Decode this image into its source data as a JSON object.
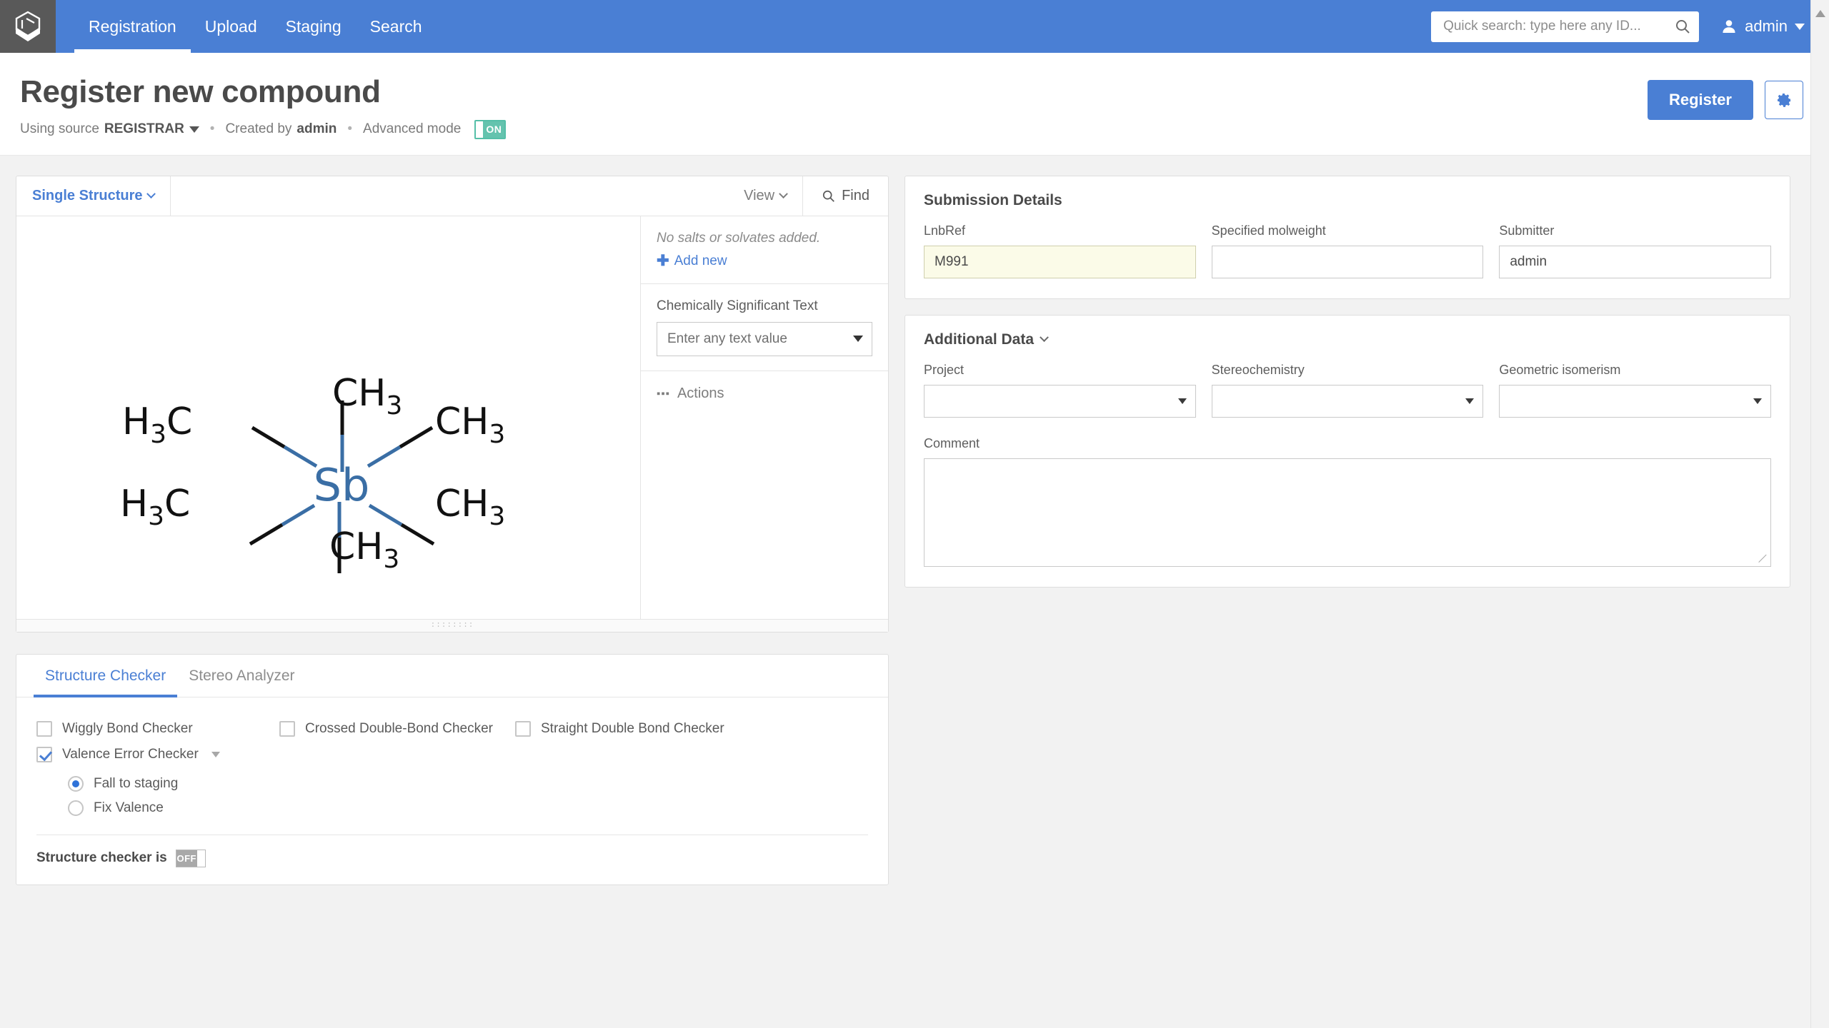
{
  "navbar": {
    "logo_icon": "hexagon-chevron-logo",
    "items": [
      {
        "label": "Registration",
        "active": true
      },
      {
        "label": "Upload",
        "active": false
      },
      {
        "label": "Staging",
        "active": false
      },
      {
        "label": "Search",
        "active": false
      }
    ],
    "search": {
      "placeholder": "Quick search: type here any ID...",
      "value": "",
      "icon": "search-icon"
    },
    "user": {
      "name": "admin",
      "icon": "user-avatar-icon",
      "caret": "chevron-down-icon"
    },
    "accent_color": "#4a7fd4"
  },
  "header": {
    "title": "Register new compound",
    "using_source_prefix": "Using source",
    "source": "REGISTRAR",
    "created_by_prefix": "Created by",
    "created_by": "admin",
    "advanced_mode_label": "Advanced mode",
    "advanced_mode_state": "ON",
    "register_button": "Register",
    "settings_icon": "gear-icon"
  },
  "editor": {
    "mode_label": "Single Structure",
    "view_label": "View",
    "find_label": "Find",
    "find_icon": "search-icon",
    "structure": {
      "center_atom": "Sb",
      "ligands": [
        "CH3",
        "CH3",
        "CH3",
        "H3C",
        "H3C",
        "H3C"
      ],
      "bond_color": "#3a6ea5",
      "atom_color": "#3a6ea5"
    }
  },
  "side_panel": {
    "salts_note": "No salts or solvates added.",
    "add_new_label": "Add new",
    "add_icon": "plus-icon",
    "cst_label": "Chemically Significant Text",
    "cst_placeholder": "Enter any text value",
    "cst_value": "",
    "actions_label": "Actions",
    "actions_icon": "ellipsis-icon"
  },
  "checker": {
    "tabs": [
      {
        "label": "Structure Checker",
        "active": true
      },
      {
        "label": "Stereo Analyzer",
        "active": false
      }
    ],
    "checkboxes": [
      {
        "label": "Wiggly Bond Checker",
        "checked": false
      },
      {
        "label": "Crossed Double-Bond Checker",
        "checked": false
      },
      {
        "label": "Straight Double Bond Checker",
        "checked": false
      },
      {
        "label": "Valence Error Checker",
        "checked": true
      }
    ],
    "radios": [
      {
        "label": "Fall to staging",
        "selected": true
      },
      {
        "label": "Fix Valence",
        "selected": false
      }
    ],
    "footer_label": "Structure checker is",
    "footer_state": "OFF"
  },
  "submission": {
    "title": "Submission Details",
    "fields": [
      {
        "label": "LnbRef",
        "value": "M991",
        "highlight": true
      },
      {
        "label": "Specified molweight",
        "value": "",
        "highlight": false
      },
      {
        "label": "Submitter",
        "value": "admin",
        "highlight": false
      }
    ]
  },
  "additional": {
    "title": "Additional Data",
    "collapse_icon": "chevron-down-icon",
    "selects": [
      {
        "label": "Project",
        "value": ""
      },
      {
        "label": "Stereochemistry",
        "value": ""
      },
      {
        "label": "Geometric isomerism",
        "value": ""
      }
    ],
    "comment_label": "Comment",
    "comment_value": ""
  },
  "scrollbar": {
    "up_arrow_icon": "triangle-up-icon"
  }
}
